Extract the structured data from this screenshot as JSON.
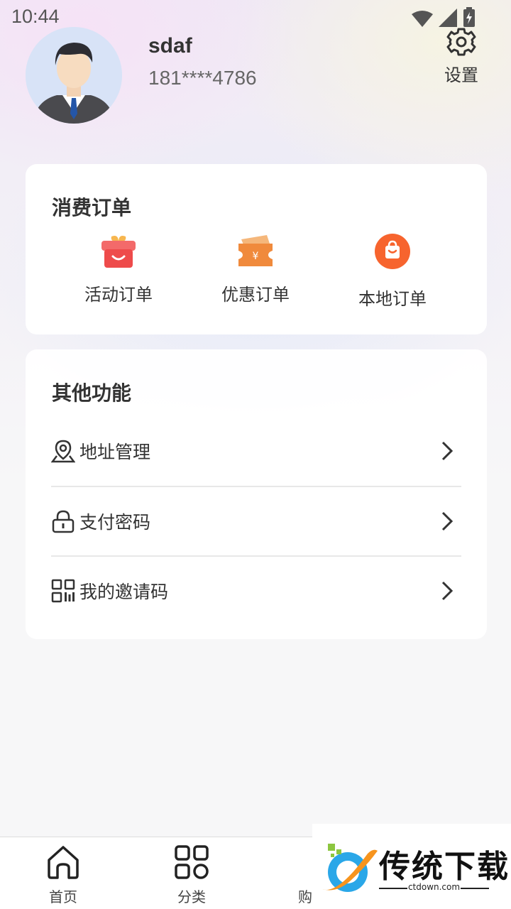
{
  "status_bar": {
    "time": "10:44"
  },
  "profile": {
    "username": "sdaf",
    "phone": "181****4786"
  },
  "settings": {
    "label": "设置"
  },
  "orders": {
    "title": "消费订单",
    "items": [
      {
        "label": "活动订单",
        "icon": "gift-icon"
      },
      {
        "label": "优惠订单",
        "icon": "coupon-icon"
      },
      {
        "label": "本地订单",
        "icon": "shopping-bag-icon"
      }
    ]
  },
  "other": {
    "title": "其他功能",
    "items": [
      {
        "label": "地址管理",
        "icon": "location-pin-icon"
      },
      {
        "label": "支付密码",
        "icon": "lock-icon"
      },
      {
        "label": "我的邀请码",
        "icon": "qr-code-icon"
      }
    ]
  },
  "tabbar": {
    "items": [
      {
        "label": "首页",
        "icon": "home-icon"
      },
      {
        "label": "分类",
        "icon": "category-icon"
      },
      {
        "label": "购",
        "icon": "cart-icon"
      }
    ]
  },
  "watermark": {
    "brand": "传统下载",
    "domain": "ctdown.com"
  },
  "colors": {
    "accent": "#f5683a",
    "card_bg": "#ffffff",
    "page_bg": "#f7f7f8"
  }
}
